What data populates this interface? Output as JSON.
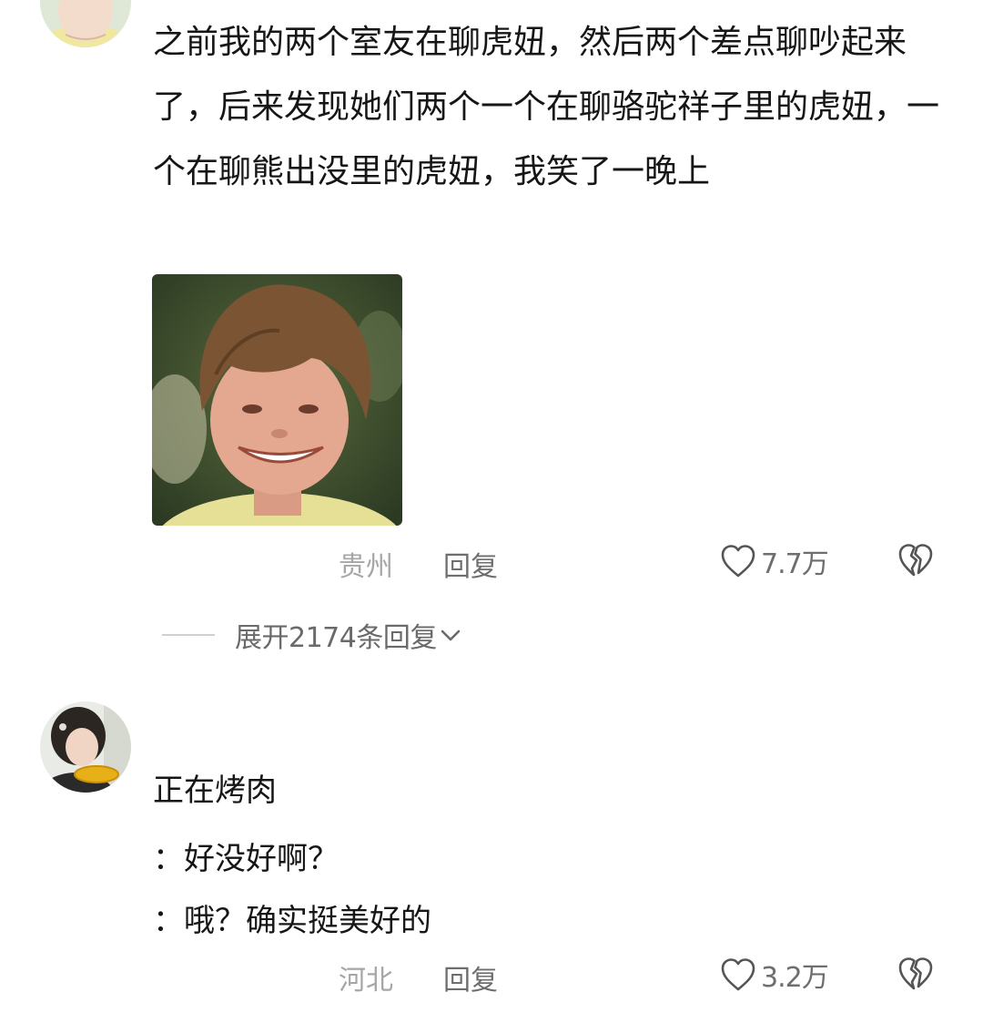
{
  "comments": [
    {
      "text": "之前我的两个室友在聊虎妞，然后两个差点聊吵起来了，后来发现她们两个一个在聊骆驼祥子里的虎妞，一个在聊熊出没里的虎妞，我笑了一晚上",
      "location": "贵州",
      "reply_label": "回复",
      "likes": "7.7万",
      "expand_label": "展开2174条回复"
    },
    {
      "lines": [
        "正在烤肉",
        "：好没好啊？",
        "：哦？确实挺美好的"
      ],
      "location": "河北",
      "reply_label": "回复",
      "likes": "3.2万"
    }
  ],
  "colors": {
    "text": "#161616",
    "secondary": "#6e6e6e",
    "location": "#a6a6a6",
    "icon": "#555555"
  },
  "icons": {
    "like": "heart-outline-icon",
    "dislike": "broken-heart-icon",
    "expand": "chevron-down-icon"
  }
}
